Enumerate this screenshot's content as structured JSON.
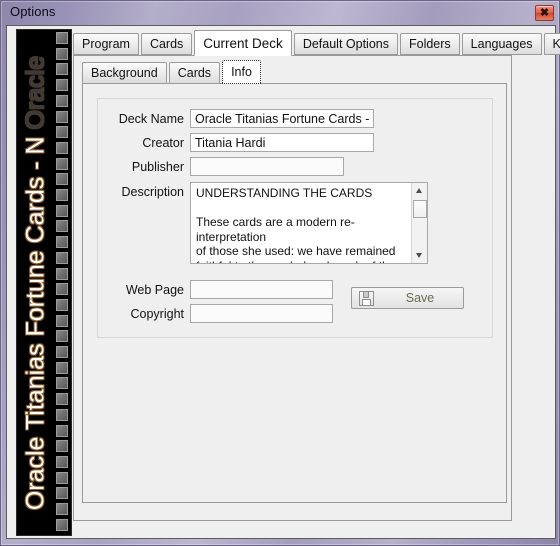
{
  "window": {
    "title": "Options",
    "close_label": "✖",
    "accent_titlebar": "#a8a1c2",
    "client_bg": "#efefef"
  },
  "banner": {
    "text_primary": "Oracle Titanias Fortune Cards - N",
    "text_faded": " Oracle",
    "bg": "#000000",
    "text_color": "#ffffff",
    "outline_color": "#8a5a28",
    "faded_color": "#3a3a40",
    "strip_square_count": 32
  },
  "outer_tabs": {
    "items": [
      {
        "label": "Program",
        "selected": false
      },
      {
        "label": "Cards",
        "selected": false
      },
      {
        "label": "Current Deck",
        "selected": true
      },
      {
        "label": "Default Options",
        "selected": false
      },
      {
        "label": "Folders",
        "selected": false
      },
      {
        "label": "Languages",
        "selected": false
      },
      {
        "label": "Keys",
        "selected": false
      }
    ]
  },
  "inner_tabs": {
    "items": [
      {
        "label": "Background",
        "selected": false,
        "focused": false
      },
      {
        "label": "Cards",
        "selected": false,
        "focused": false
      },
      {
        "label": "Info",
        "selected": true,
        "focused": true
      }
    ]
  },
  "info_form": {
    "fields": {
      "deck_name": {
        "label": "Deck Name",
        "value": "Oracle Titanias Fortune Cards - N",
        "placeholder": ""
      },
      "creator": {
        "label": "Creator",
        "value": "Titania Hardi",
        "placeholder": ""
      },
      "publisher": {
        "label": "Publisher",
        "value": "",
        "placeholder": ""
      },
      "description": {
        "label": "Description",
        "value": "UNDERSTANDING THE CARDS\n\nThese cards are a modern re-interpretation\nof those she used: we have remained\nfaithful to the symbol and much of the"
      },
      "web_page": {
        "label": "Web Page",
        "value": "",
        "placeholder": ""
      },
      "copyright": {
        "label": "Copyright",
        "value": "",
        "placeholder": ""
      }
    },
    "save": {
      "label": "Save",
      "icon": "floppy-disk-icon",
      "disabled": true,
      "label_color": "#6b6b55"
    },
    "description_scroll": {
      "up_icon": "scroll-up-arrow-icon",
      "down_icon": "scroll-down-arrow-icon",
      "thumb_position_pct": 3
    }
  }
}
